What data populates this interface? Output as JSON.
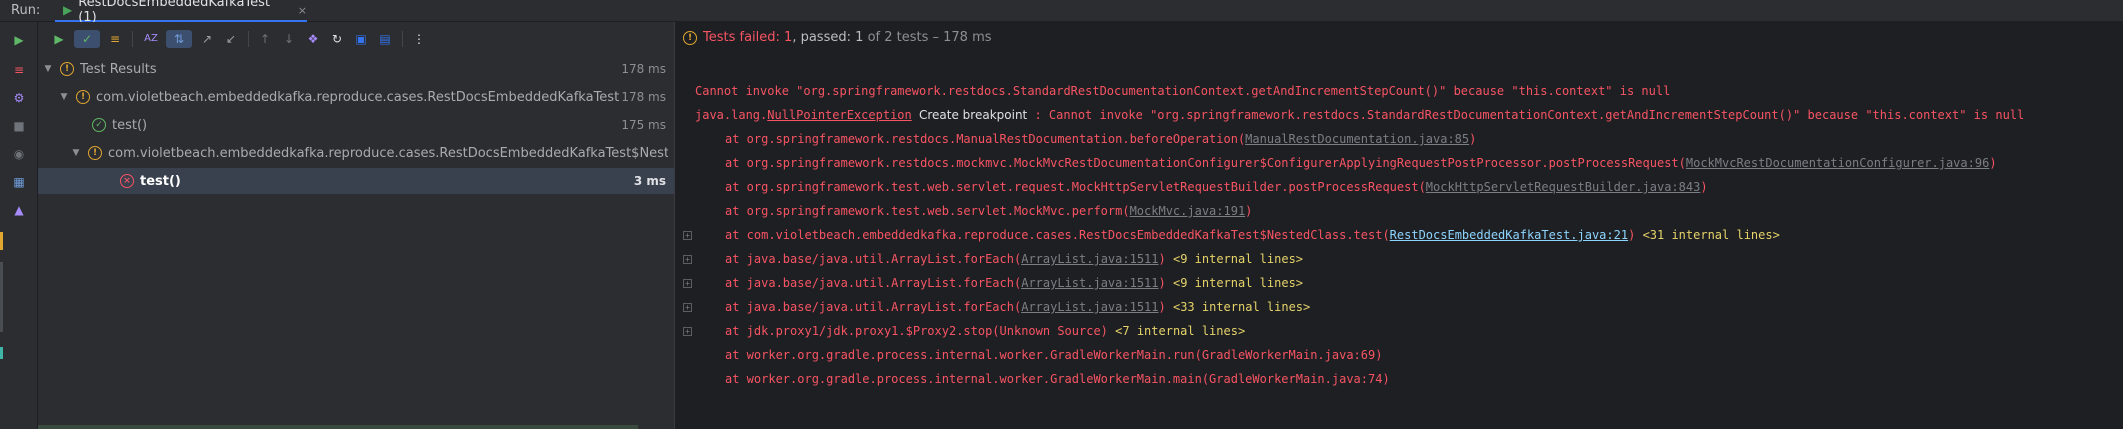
{
  "run_bar": {
    "label": "Run:",
    "tab_title": "RestDocsEmbeddedKafkaTest (1)",
    "close_glyph": "×"
  },
  "colors": {
    "error": "#f75464",
    "warning": "#e0a630",
    "pass": "#5fb865",
    "accent": "#3574f0",
    "internal_lines": "#e6d36a"
  },
  "left_strip": {
    "icons": [
      "run-icon",
      "stop-all-icon",
      "settings-icon",
      "stop-icon",
      "eye-icon",
      "layout-icon",
      "pin-icon"
    ]
  },
  "toolbar": {
    "icons": [
      "run-icon",
      "show-passed-icon",
      "show-ignored-icon",
      "sort-alphabetically-icon",
      "sort-by-duration-icon",
      "expand-all-icon",
      "collapse-all-icon",
      "previous-failed-icon",
      "next-failed-icon",
      "test-history-icon",
      "rerun-history-icon",
      "import-tests-icon",
      "export-tests-icon",
      "more-options-icon"
    ]
  },
  "tree": {
    "rows": [
      {
        "label": "Test Results",
        "time": "178 ms",
        "status": "warning"
      },
      {
        "label": "com.violetbeach.embeddedkafka.reproduce.cases.RestDocsEmbeddedKafkaTest",
        "time": "178 ms",
        "status": "warning"
      },
      {
        "label": "test()",
        "time": "175 ms",
        "status": "passed"
      },
      {
        "label": "com.violetbeach.embeddedkafka.reproduce.cases.RestDocsEmbeddedKafkaTest$NestedClass",
        "time": "",
        "status": "warning"
      },
      {
        "label": "test()",
        "time": "3 ms",
        "status": "failed"
      }
    ]
  },
  "summary": {
    "failed_label": "Tests failed:",
    "failed_count": "1",
    "passed_label": ", passed:",
    "passed_count": "1",
    "rest": "of 2 tests – 178 ms"
  },
  "console": {
    "message": "Cannot invoke \"org.springframework.restdocs.StandardRestDocumentationContext.getAndIncrementStepCount()\" because \"this.context\" is null",
    "exception_class": "java.lang.NullPointerException",
    "create_breakpoint": "Create breakpoint",
    "exception_message": ": Cannot invoke \"org.springframework.restdocs.StandardRestDocumentationContext.getAndIncrementStepCount()\" because \"this.context\" is null",
    "frames": [
      {
        "text": "at org.springframework.restdocs.ManualRestDocumentation.beforeOperation(",
        "link": "ManualRestDocumentation.java:85",
        "tail": ")",
        "internal": ""
      },
      {
        "text": "at org.springframework.restdocs.mockmvc.MockMvcRestDocumentationConfigurer$ConfigurerApplyingRequestPostProcessor.postProcessRequest(",
        "link": "MockMvcRestDocumentationConfigurer.java:96",
        "tail": ")",
        "internal": ""
      },
      {
        "text": "at org.springframework.test.web.servlet.request.MockHttpServletRequestBuilder.postProcessRequest(",
        "link": "MockHttpServletRequestBuilder.java:843",
        "tail": ")",
        "internal": ""
      },
      {
        "text": "at org.springframework.test.web.servlet.MockMvc.perform(",
        "link": "MockMvc.java:191",
        "tail": ")",
        "internal": ""
      },
      {
        "text": "at com.violetbeach.embeddedkafka.reproduce.cases.RestDocsEmbeddedKafkaTest$NestedClass.test(",
        "link": "RestDocsEmbeddedKafkaTest.java:21",
        "tail": ")",
        "internal": "<31 internal lines>"
      },
      {
        "text": "at java.base/java.util.ArrayList.forEach(",
        "link": "ArrayList.java:1511",
        "tail": ")",
        "internal": "<9 internal lines>"
      },
      {
        "text": "at java.base/java.util.ArrayList.forEach(",
        "link": "ArrayList.java:1511",
        "tail": ")",
        "internal": "<9 internal lines>"
      },
      {
        "text": "at java.base/java.util.ArrayList.forEach(",
        "link": "ArrayList.java:1511",
        "tail": ")",
        "internal": "<33 internal lines>"
      },
      {
        "text": "at jdk.proxy1/jdk.proxy1.$Proxy2.stop(Unknown Source)",
        "link": "",
        "tail": "",
        "internal": "<7 internal lines>"
      },
      {
        "text": "at worker.org.gradle.process.internal.worker.GradleWorkerMain.run(GradleWorkerMain.java:69)",
        "link": "",
        "tail": "",
        "internal": ""
      },
      {
        "text": "at worker.org.gradle.process.internal.worker.GradleWorkerMain.main(GradleWorkerMain.java:74)",
        "link": "",
        "tail": "",
        "internal": ""
      }
    ]
  }
}
